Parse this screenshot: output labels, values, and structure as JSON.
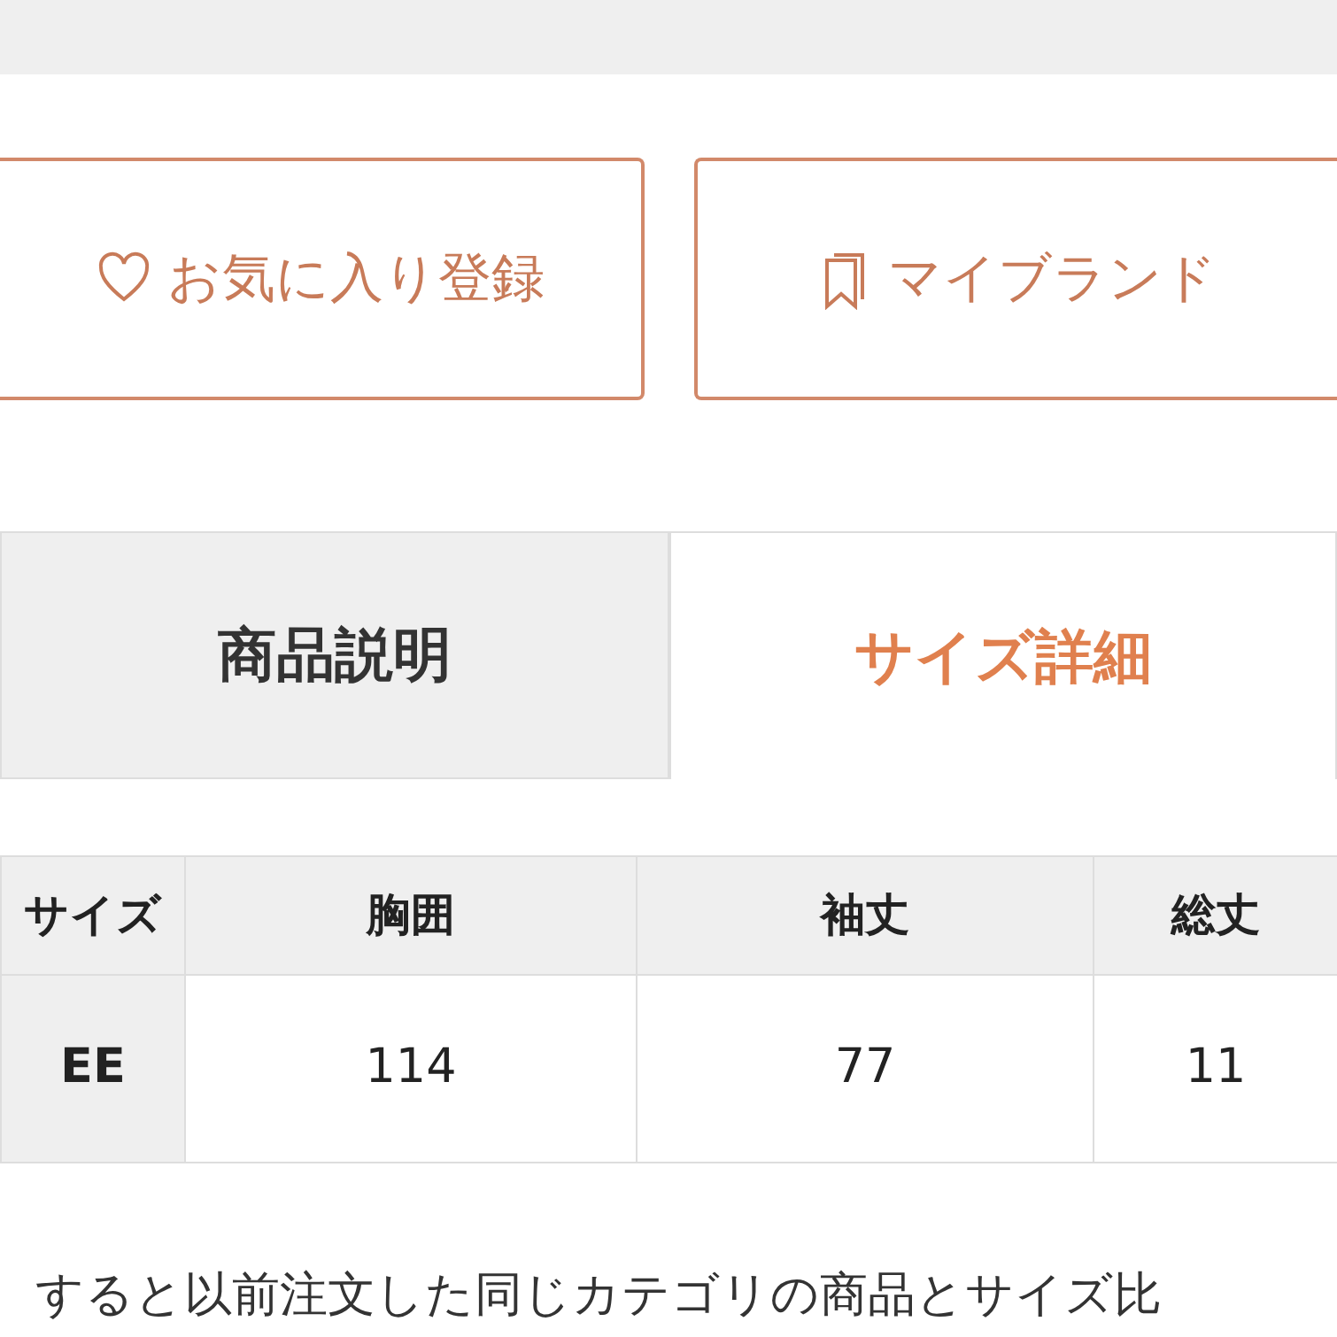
{
  "buttons": [
    {
      "kind": "heart",
      "label": "お気に入り登録"
    },
    {
      "kind": "bookmark",
      "label": "マイブランド"
    }
  ],
  "tabs": [
    {
      "label": "商品説明",
      "selected": false
    },
    {
      "label": "サイズ詳細",
      "selected": true
    }
  ],
  "table": {
    "columns": [
      "サイズ",
      "胸囲",
      "袖丈",
      "総丈"
    ],
    "rows": [
      [
        "EE",
        "114",
        "77",
        "11"
      ]
    ]
  },
  "note": "すると以前注文した同じカテゴリの商品とサイズ比"
}
